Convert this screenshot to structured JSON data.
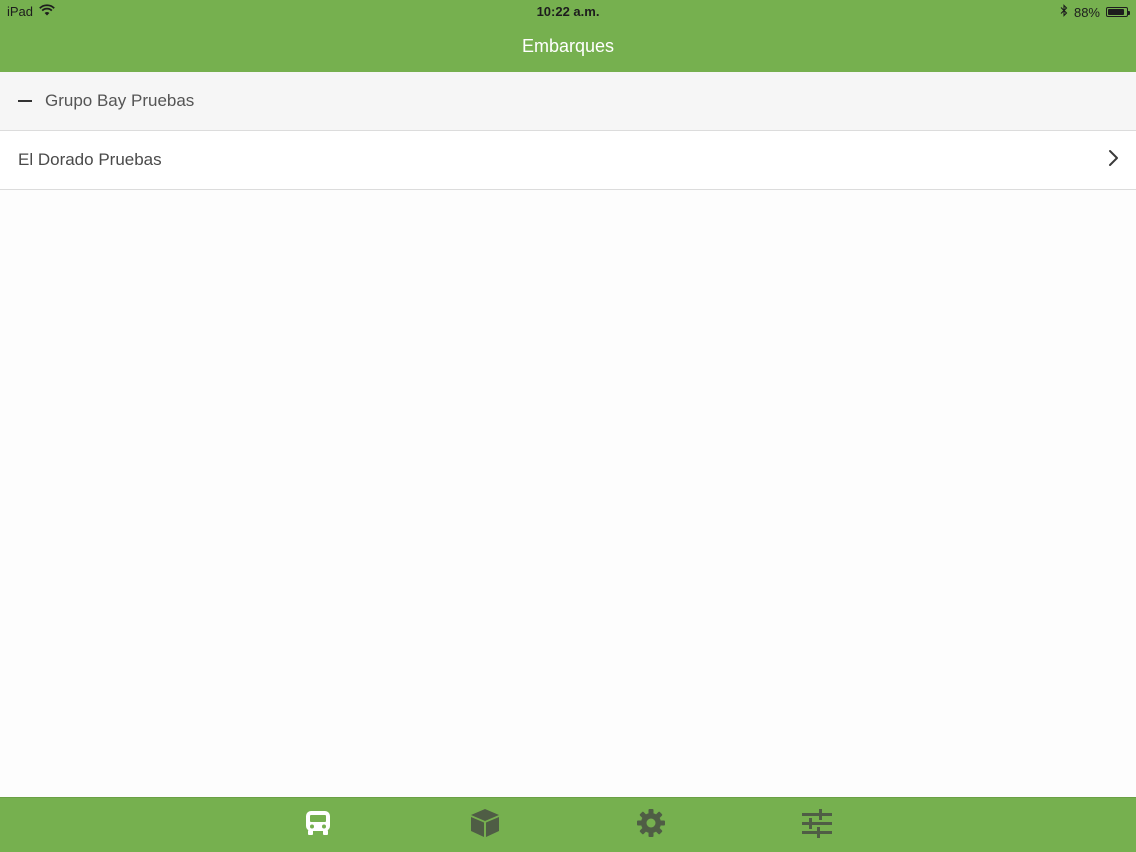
{
  "status_bar": {
    "device": "iPad",
    "time": "10:22 a.m.",
    "battery": "88%",
    "battery_level": 0.88
  },
  "nav": {
    "title": "Embarques"
  },
  "list": {
    "group_title": "Grupo Bay Pruebas",
    "items": [
      {
        "label": "El Dorado Pruebas"
      }
    ]
  },
  "tabbar": {
    "tabs": [
      {
        "icon": "bus-icon",
        "selected": true
      },
      {
        "icon": "box-icon",
        "selected": false
      },
      {
        "icon": "gear-icon",
        "selected": false
      },
      {
        "icon": "sliders-icon",
        "selected": false
      }
    ]
  },
  "colors": {
    "accent": "#76b04f",
    "tab_active": "#ffffff",
    "tab_inactive": "#4f5d45"
  }
}
